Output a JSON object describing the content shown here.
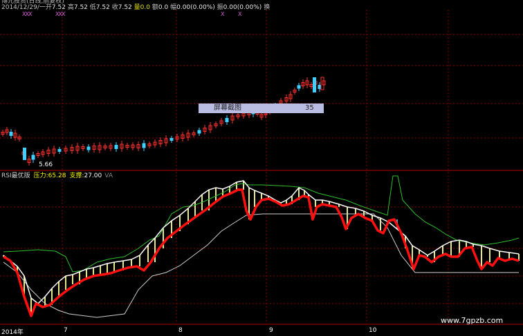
{
  "header": {
    "title": "博元投资(日线,前复权)",
    "date": "2014/12/29/一",
    "open_label": "开",
    "open": "7.52",
    "high_label": "高",
    "high": "7.52",
    "low_label": "低",
    "low": "7.52",
    "close_label": "收",
    "close": "7.52",
    "volume_label": "量",
    "volume": "0.0",
    "amount_label": "额",
    "amount": "0.0",
    "change_label": "幅",
    "change": "0.00(0.00%)",
    "amplitude_label": "振",
    "amplitude": "0.00(0.00%)",
    "turnover_label": "换"
  },
  "markers": {
    "left": "XXX",
    "mid": "XXX",
    "right1": "X",
    "right2": "X"
  },
  "screenshot_badge": {
    "label": "屏幕截图",
    "value": "35"
  },
  "price_low_label": "5.66",
  "rsi": {
    "name": "RSI最优版",
    "pressure_label": "压力:",
    "pressure": "65.28",
    "support_label": "支撑:",
    "support": "27.00",
    "extra": "VA"
  },
  "x_axis": {
    "labels": [
      "2014年",
      "7",
      "8",
      "9",
      "10"
    ]
  },
  "watermark": "www.7gpzb.com",
  "colors": {
    "background": "#000000",
    "grid": "#8b0000",
    "up_candle": "#ff3030",
    "down_candle": "#40d0ff",
    "rsi_thick": "#ff1010",
    "rsi_white": "#ffffff",
    "rsi_green": "#30c030",
    "rsi_bars_blue": "#6fa8dc",
    "rsi_bars_yellow": "#ffff99"
  }
}
